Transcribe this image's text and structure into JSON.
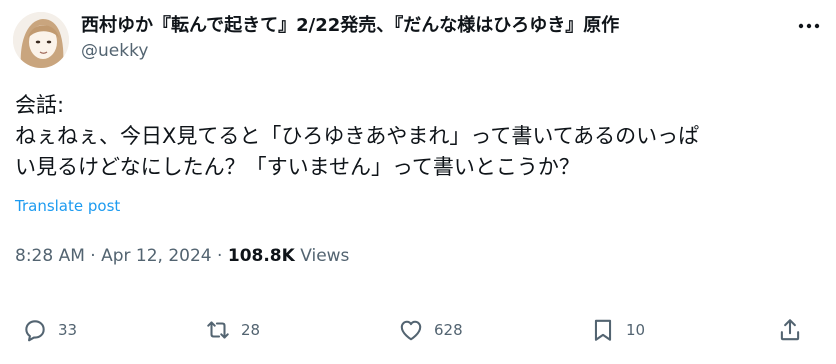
{
  "author": {
    "display_name": "西村ゆか『転んで起きて』2/22発売、『だんな様はひろゆき』原作",
    "handle": "@uekky"
  },
  "tweet": {
    "lines": [
      "会話:",
      "ねぇねぇ、今日X見てると「ひろゆきあやまれ」って書いてあるのいっぱ",
      "い見るけどなにしたん？「すいません」って書いとこうか？"
    ],
    "translate_label": "Translate post"
  },
  "meta": {
    "time": "8:28 AM",
    "separator": "·",
    "date": "Apr 12, 2024",
    "views_count": "108.8K",
    "views_label": "Views"
  },
  "actions": {
    "replies": "33",
    "reposts": "28",
    "likes": "628",
    "bookmarks": "10"
  }
}
